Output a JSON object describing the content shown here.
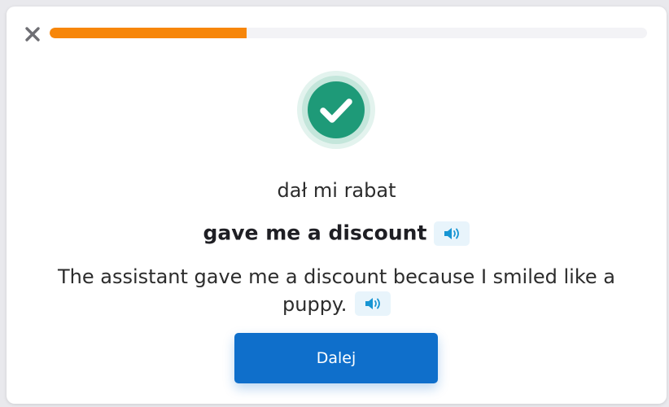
{
  "header": {
    "close_icon": "close-icon",
    "progress": 0.33,
    "progress_color": "#f78609"
  },
  "result": {
    "status_icon": "checkmark-icon",
    "status_color": "#1e9a78",
    "source_phrase": "dał mi rabat",
    "target_phrase": "gave me a discount",
    "example_sentence": "The assistant gave me a discount because I smiled like a puppy.",
    "audio_icon": "speaker-icon"
  },
  "actions": {
    "next_label": "Dalej",
    "next_color": "#0f6fcb"
  }
}
